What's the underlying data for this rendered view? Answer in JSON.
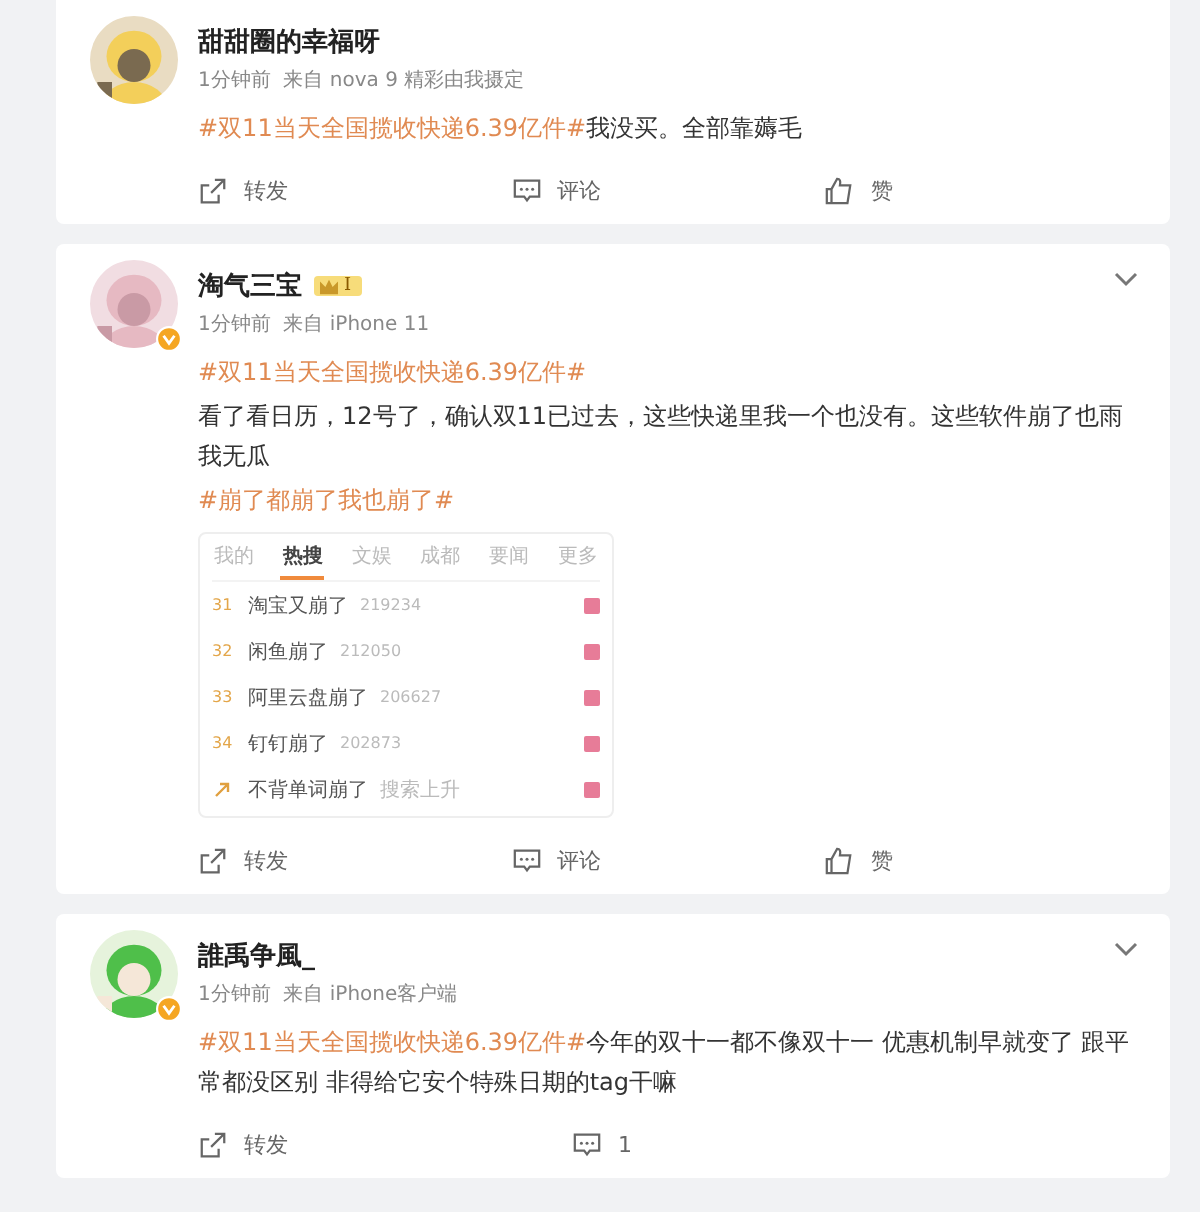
{
  "posts": [
    {
      "avatar": {
        "kind": "picture"
      },
      "verified": false,
      "name": "甜甜圈的幸福呀",
      "menu": false,
      "meta": "1分钟前  来自 nova 9 精彩由我摄定",
      "paragraphs": [
        [
          {
            "kind": "tag",
            "text": "#双11当天全国揽收快递6.39亿件#"
          },
          {
            "kind": "text",
            "text": "我没买。全部靠薅毛"
          }
        ]
      ],
      "actions": [
        {
          "kind": "repost",
          "label": "转发"
        },
        {
          "kind": "comment",
          "label": "评论"
        },
        {
          "kind": "like",
          "label": "赞"
        }
      ]
    },
    {
      "avatar": {
        "kind": "picture"
      },
      "verified": true,
      "name": "淘气三宝",
      "badge": "I",
      "menu": true,
      "meta": "1分钟前  来自 iPhone 11",
      "paragraphs": [
        [
          {
            "kind": "tag",
            "text": "#双11当天全国揽收快递6.39亿件#"
          }
        ],
        [
          {
            "kind": "text",
            "text": "看了看日历，12号了，确认双11已过去，这些快递里我一个也没有。这些软件崩了也雨我无瓜"
          }
        ],
        [
          {
            "kind": "tag",
            "text": "#崩了都崩了我也崩了#"
          }
        ]
      ],
      "trending": {
        "tabs": [
          {
            "label": "我的",
            "selected": false
          },
          {
            "label": "热搜",
            "selected": true
          },
          {
            "label": "文娱",
            "selected": false
          },
          {
            "label": "成都",
            "selected": false
          },
          {
            "label": "要闻",
            "selected": false
          },
          {
            "label": "更多",
            "selected": false
          }
        ],
        "rows": [
          {
            "kind": "rank",
            "rank": "31",
            "title": "淘宝又崩了",
            "count": "219234"
          },
          {
            "kind": "rank",
            "rank": "32",
            "title": "闲鱼崩了",
            "count": "212050"
          },
          {
            "kind": "rank",
            "rank": "33",
            "title": "阿里云盘崩了",
            "count": "206627"
          },
          {
            "kind": "rank",
            "rank": "34",
            "title": "钉钉崩了",
            "count": "202873"
          },
          {
            "kind": "rising",
            "title": "不背单词崩了",
            "count": "搜索上升"
          }
        ]
      },
      "actions": [
        {
          "kind": "repost",
          "label": "转发"
        },
        {
          "kind": "comment",
          "label": "评论"
        },
        {
          "kind": "like",
          "label": "赞"
        }
      ]
    },
    {
      "avatar": {
        "kind": "picture"
      },
      "verified": true,
      "name": "誰禹争風_",
      "menu": true,
      "meta": "1分钟前  来自 iPhone客户端",
      "paragraphs": [
        [
          {
            "kind": "tag",
            "text": "#双11当天全国揽收快递6.39亿件#"
          },
          {
            "kind": "text",
            "text": "今年的双十一都不像双十一 优惠机制早就变了 跟平常都没区别 非得给它安个特殊日期的tag干嘛"
          }
        ]
      ],
      "actions": [
        {
          "kind": "repost",
          "label": "转发"
        },
        {
          "kind": "comment",
          "label": "1"
        }
      ]
    }
  ]
}
